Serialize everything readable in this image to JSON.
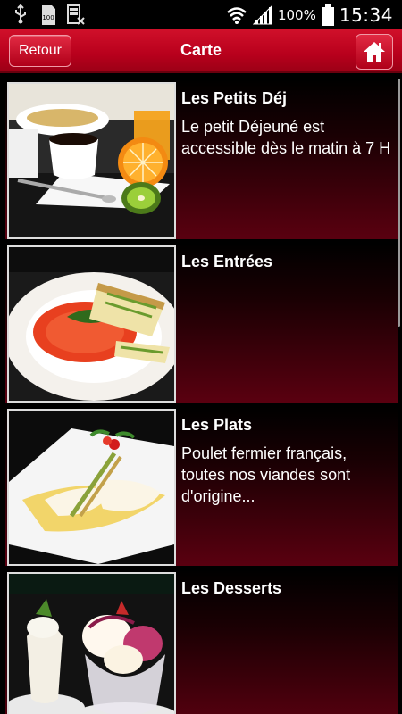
{
  "status": {
    "battery_percent": "100%",
    "time": "15:34"
  },
  "header": {
    "back_label": "Retour",
    "title": "Carte"
  },
  "menu": [
    {
      "title": "Les Petits Déj",
      "description": "Le petit Déjeuné est accessible dès le matin à 7 H"
    },
    {
      "title": "Les Entrées",
      "description": ""
    },
    {
      "title": "Les Plats",
      "description": "Poulet fermier français, toutes nos viandes sont d'origine..."
    },
    {
      "title": "Les Desserts",
      "description": ""
    }
  ],
  "colors": {
    "header_red": "#c8001e",
    "accent_dark_red": "#5a0010"
  }
}
